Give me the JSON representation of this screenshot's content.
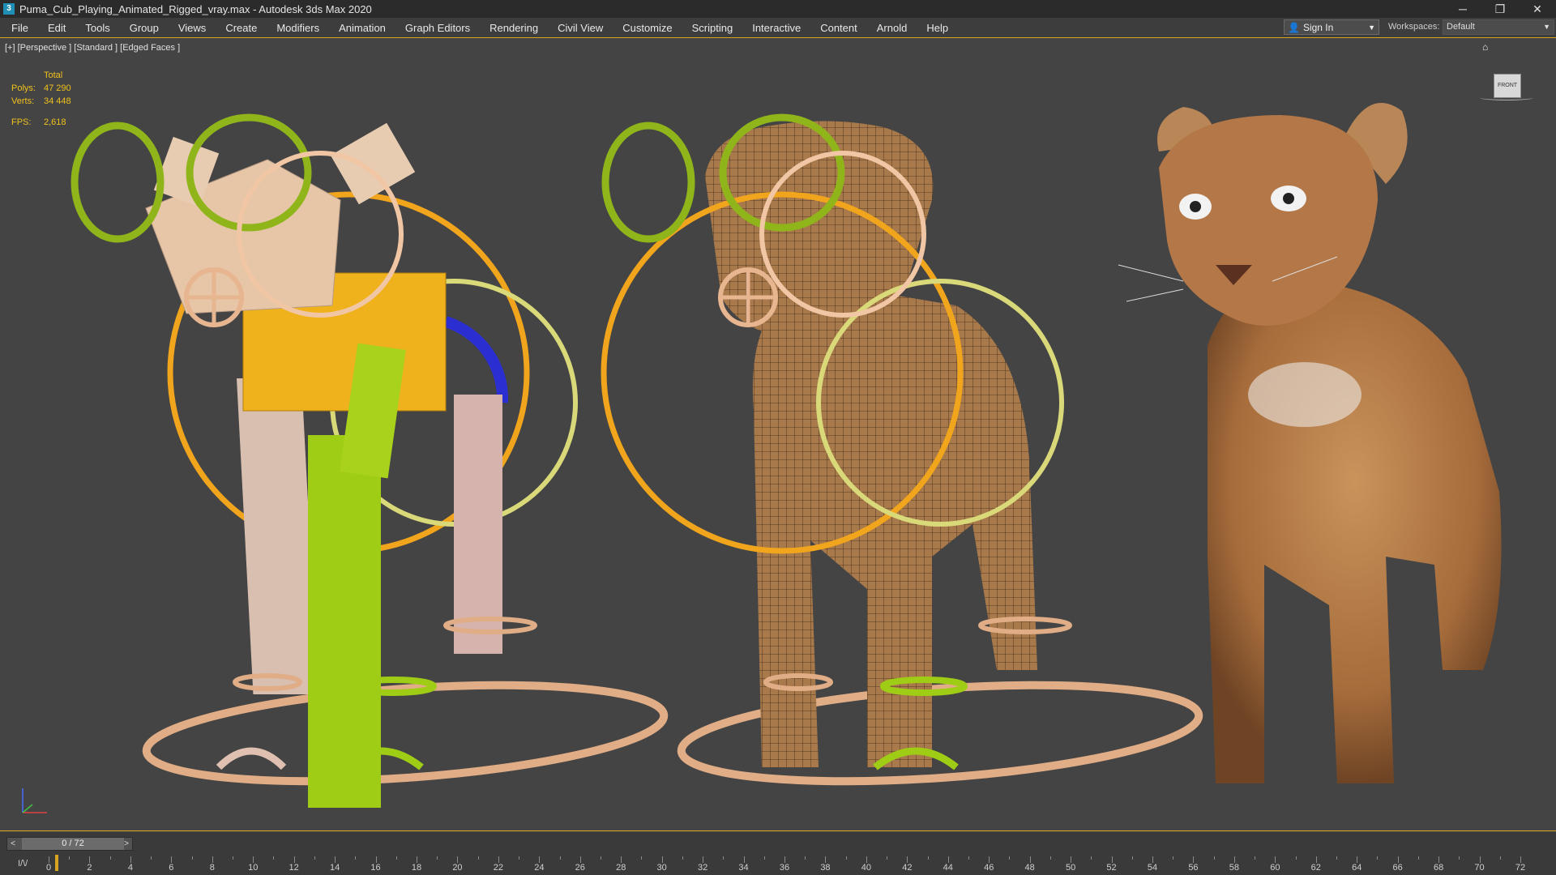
{
  "window": {
    "title": "Puma_Cub_Playing_Animated_Rigged_vray.max - Autodesk 3ds Max 2020",
    "app_icon": "3",
    "minimize": "─",
    "restore": "❐",
    "close": "✕"
  },
  "menu": [
    "File",
    "Edit",
    "Tools",
    "Group",
    "Views",
    "Create",
    "Modifiers",
    "Animation",
    "Graph Editors",
    "Rendering",
    "Civil View",
    "Customize",
    "Scripting",
    "Interactive",
    "Content",
    "Arnold",
    "Help"
  ],
  "account": {
    "sign_in": "Sign In",
    "workspaces_label": "Workspaces:",
    "workspace": "Default"
  },
  "viewport": {
    "label": "[+] [Perspective ] [Standard ] [Edged Faces ]",
    "stats": {
      "header": "Total",
      "polys_label": "Polys:",
      "polys": "47 290",
      "verts_label": "Verts:",
      "verts": "34 448",
      "fps_label": "FPS:",
      "fps": "2,618"
    },
    "viewcube": "FRONT"
  },
  "timeline": {
    "position": "0 / 72",
    "prev": "<",
    "next": ">",
    "ticks": [
      "0",
      "2",
      "4",
      "6",
      "8",
      "10",
      "12",
      "14",
      "16",
      "18",
      "20",
      "22",
      "24",
      "26",
      "28",
      "30",
      "32",
      "34",
      "36",
      "38",
      "40",
      "42",
      "44",
      "46",
      "48",
      "50",
      "52",
      "54",
      "56",
      "58",
      "60",
      "62",
      "64",
      "66",
      "68",
      "70",
      "72"
    ],
    "current_frame": 0,
    "curve_icon": "I/\\/"
  },
  "colors": {
    "accent": "#d8a520",
    "viewport_bg": "#444444"
  }
}
